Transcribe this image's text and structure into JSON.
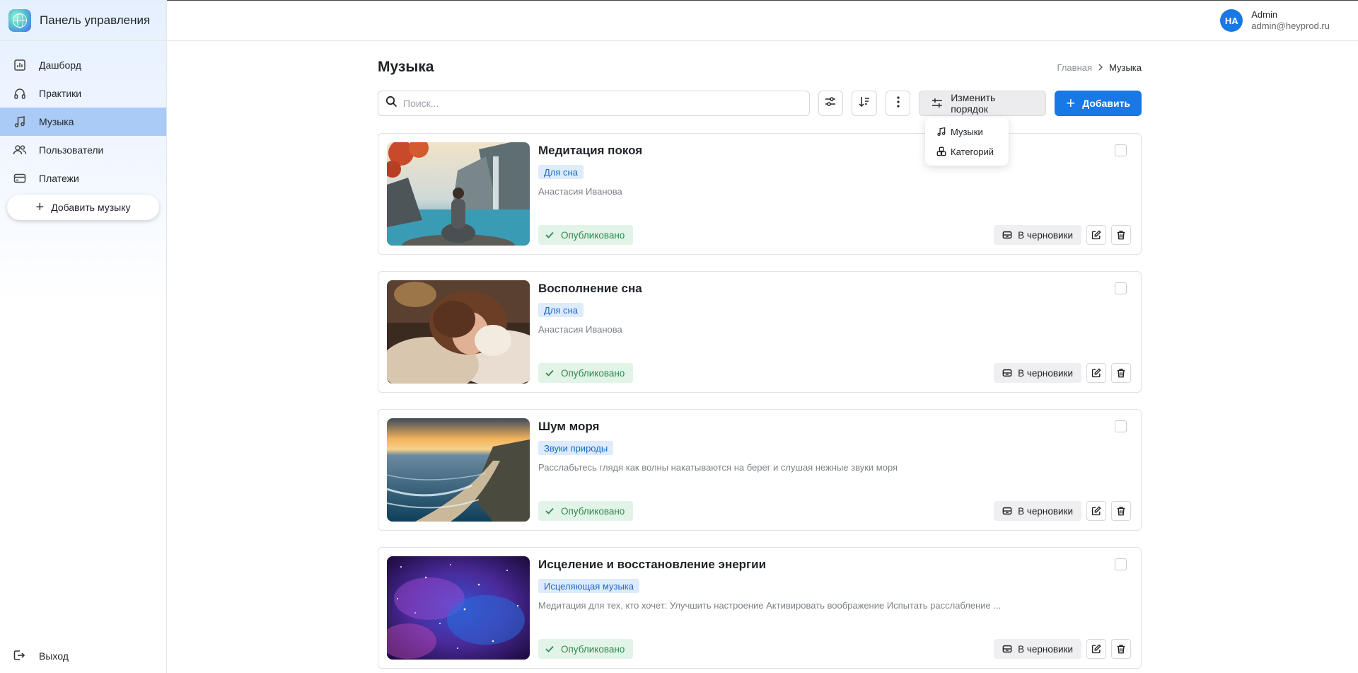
{
  "brand": {
    "title": "Панель управления"
  },
  "sidebar": {
    "items": [
      {
        "label": "Дашборд",
        "icon": "chart-icon"
      },
      {
        "label": "Практики",
        "icon": "headphones-icon"
      },
      {
        "label": "Музыка",
        "icon": "music-note-icon",
        "active": true
      },
      {
        "label": "Пользователи",
        "icon": "users-icon"
      },
      {
        "label": "Платежи",
        "icon": "card-icon"
      }
    ],
    "add_music_label": "Добавить музыку",
    "logout_label": "Выход"
  },
  "user": {
    "initials": "HA",
    "name": "Admin",
    "email": "admin@heyprod.ru"
  },
  "page": {
    "title": "Музыка",
    "breadcrumb": {
      "home": "Главная",
      "current": "Музыка"
    }
  },
  "toolbar": {
    "search_placeholder": "Поиск...",
    "reorder_label": "Изменить порядок",
    "add_label": "Добавить"
  },
  "reorder_menu": {
    "items": [
      "Музыки",
      "Категорий"
    ]
  },
  "cards": [
    {
      "title": "Медитация покоя",
      "tag": "Для сна",
      "description": "Анастасия Иванова",
      "status": "Опубликовано",
      "draft_label": "В черновики"
    },
    {
      "title": "Восполнение сна",
      "tag": "Для сна",
      "description": "Анастасия Иванова",
      "status": "Опубликовано",
      "draft_label": "В черновики"
    },
    {
      "title": "Шум моря",
      "tag": "Звуки природы",
      "description": "Расслабьтесь глядя как волны накатываются на берег и слушая нежные звуки моря",
      "status": "Опубликовано",
      "draft_label": "В черновики"
    },
    {
      "title": "Исцеление и восстановление энергии",
      "tag": "Исцеляющая музыка",
      "description": "Медитация для тех, кто хочет: Улучшить настроение Активировать воображение Испытать расслабление ...",
      "status": "Опубликовано",
      "draft_label": "В черновики"
    }
  ],
  "colors": {
    "accent": "#1778e6",
    "active_nav": "#a9cbf5",
    "status_green": "#2f8a4d",
    "tag_blue": "#1a66c7"
  }
}
